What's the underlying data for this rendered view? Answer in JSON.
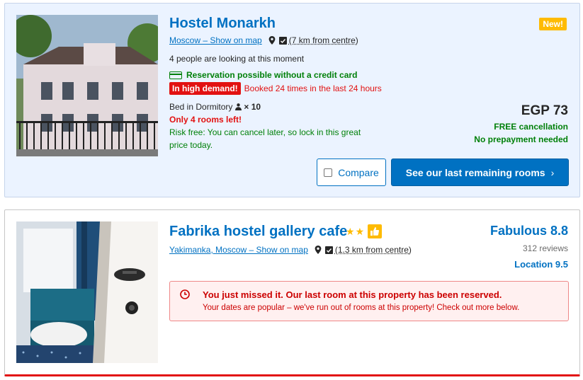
{
  "listings": [
    {
      "name": "Hostel Monarkh",
      "location_link": "Moscow – Show on map",
      "distance": "(7 km from centre)",
      "viewers": "4 people are looking at this moment",
      "credit_card_note": "Reservation possible without a credit card",
      "demand_badge": "In high demand!",
      "demand_text": "Booked 24 times in the last 24 hours",
      "room_type": "Bed in Dormitory",
      "occupancy": "× 10",
      "rooms_left": "Only 4 rooms left!",
      "risk_free": "Risk free: You can cancel later, so lock in this great",
      "risk_free_2": "price today.",
      "new_badge": "New!",
      "price": "EGP 73",
      "free_cancellation": "FREE cancellation",
      "no_prepayment": "No prepayment needed",
      "compare_label": "Compare",
      "cta_label": "See our last remaining rooms",
      "cta_chevron": "›"
    },
    {
      "name": "Fabrika hostel gallery cafe",
      "stars": 2,
      "location_link": "Yakimanka, Moscow – Show on map",
      "distance": "(1.3 km from centre)",
      "score_label": "Fabulous 8.8",
      "reviews": "312 reviews",
      "location_score": "Location 9.5",
      "missed_title": "You just missed it. Our last room at this property has been reserved.",
      "missed_sub": "Your dates are popular – we've run out of rooms at this property! Check out more below."
    }
  ],
  "icons": {
    "pin": "map-pin-icon",
    "map": "map-icon",
    "person": "person-icon",
    "credit_card": "credit-card-icon",
    "clock": "clock-icon",
    "thumb": "thumbs-up-icon",
    "star": "star-icon"
  },
  "colors": {
    "brand_blue": "#0071c2",
    "green": "#008009",
    "red": "#e21111",
    "yellow": "#febb02",
    "card_highlight_bg": "#ebf3ff"
  }
}
